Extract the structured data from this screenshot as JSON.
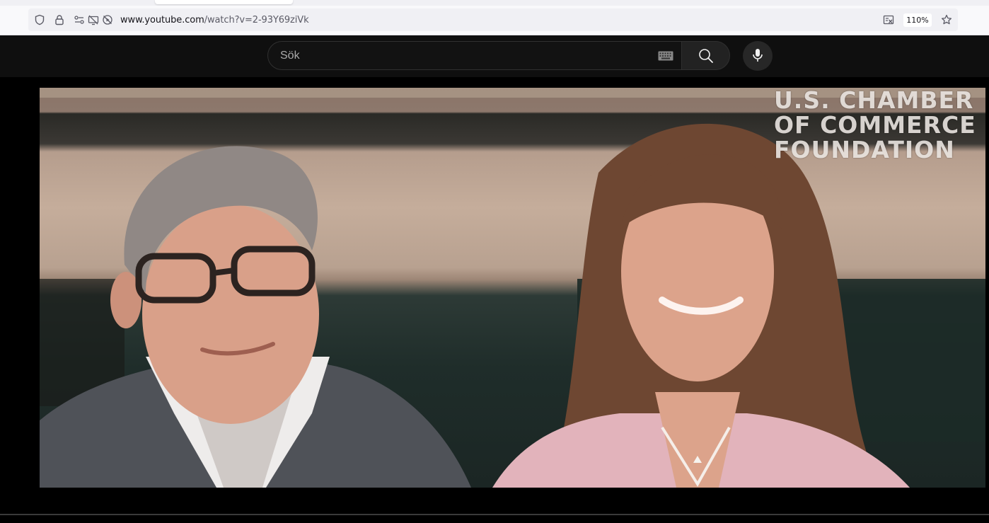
{
  "browser": {
    "url_host": "www.youtube.com",
    "url_path": "/watch?v=2-93Y69ziVk",
    "zoom_level": "110%",
    "icons": [
      "shield-icon",
      "lock-icon",
      "permissions-icon",
      "camera-blocked-icon",
      "autoplay-blocked-icon",
      "reader-view-icon",
      "bookmark-star-icon"
    ]
  },
  "masthead": {
    "search_placeholder": "Sök",
    "icons": [
      "keyboard-icon",
      "search-icon",
      "microphone-icon"
    ]
  },
  "video": {
    "watermark_lines": [
      "U.S. CHAMBER",
      "OF COMMERCE",
      "FOUNDATION"
    ]
  },
  "colors": {
    "page_background": "#000000",
    "masthead_background": "#0f0f0f",
    "browser_toolbar": "#f9f9fb"
  }
}
